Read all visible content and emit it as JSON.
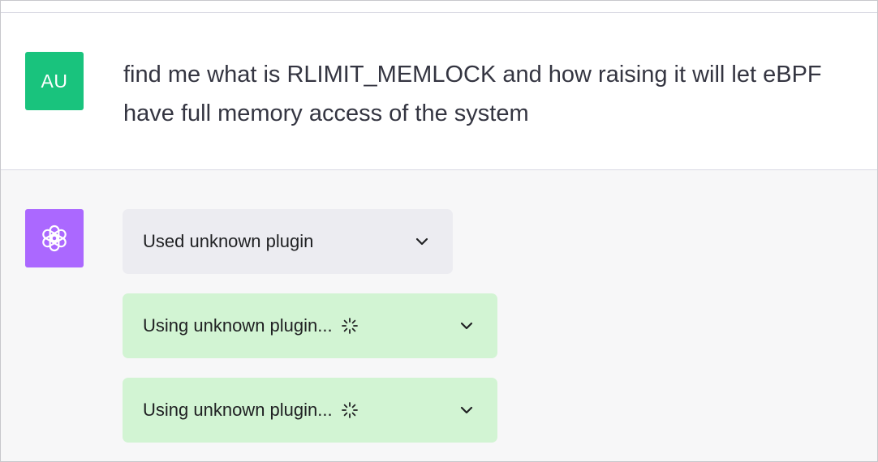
{
  "user_message": {
    "avatar_initials": "AU",
    "text": "find me what is RLIMIT_MEMLOCK and how raising it will let eBPF\nhave full memory access of the system"
  },
  "assistant": {
    "avatar_icon": "openai-logo-icon",
    "plugin_cards": [
      {
        "label": "Used unknown plugin",
        "status": "done"
      },
      {
        "label": "Using unknown plugin...",
        "status": "loading"
      },
      {
        "label": "Using unknown plugin...",
        "status": "loading"
      }
    ]
  },
  "colors": {
    "user_avatar": "#19c37d",
    "assistant_avatar": "#ab68ff",
    "used_card_bg": "#ececf1",
    "using_card_bg": "#d2f4d3",
    "assistant_row_bg": "#f7f7f8"
  }
}
